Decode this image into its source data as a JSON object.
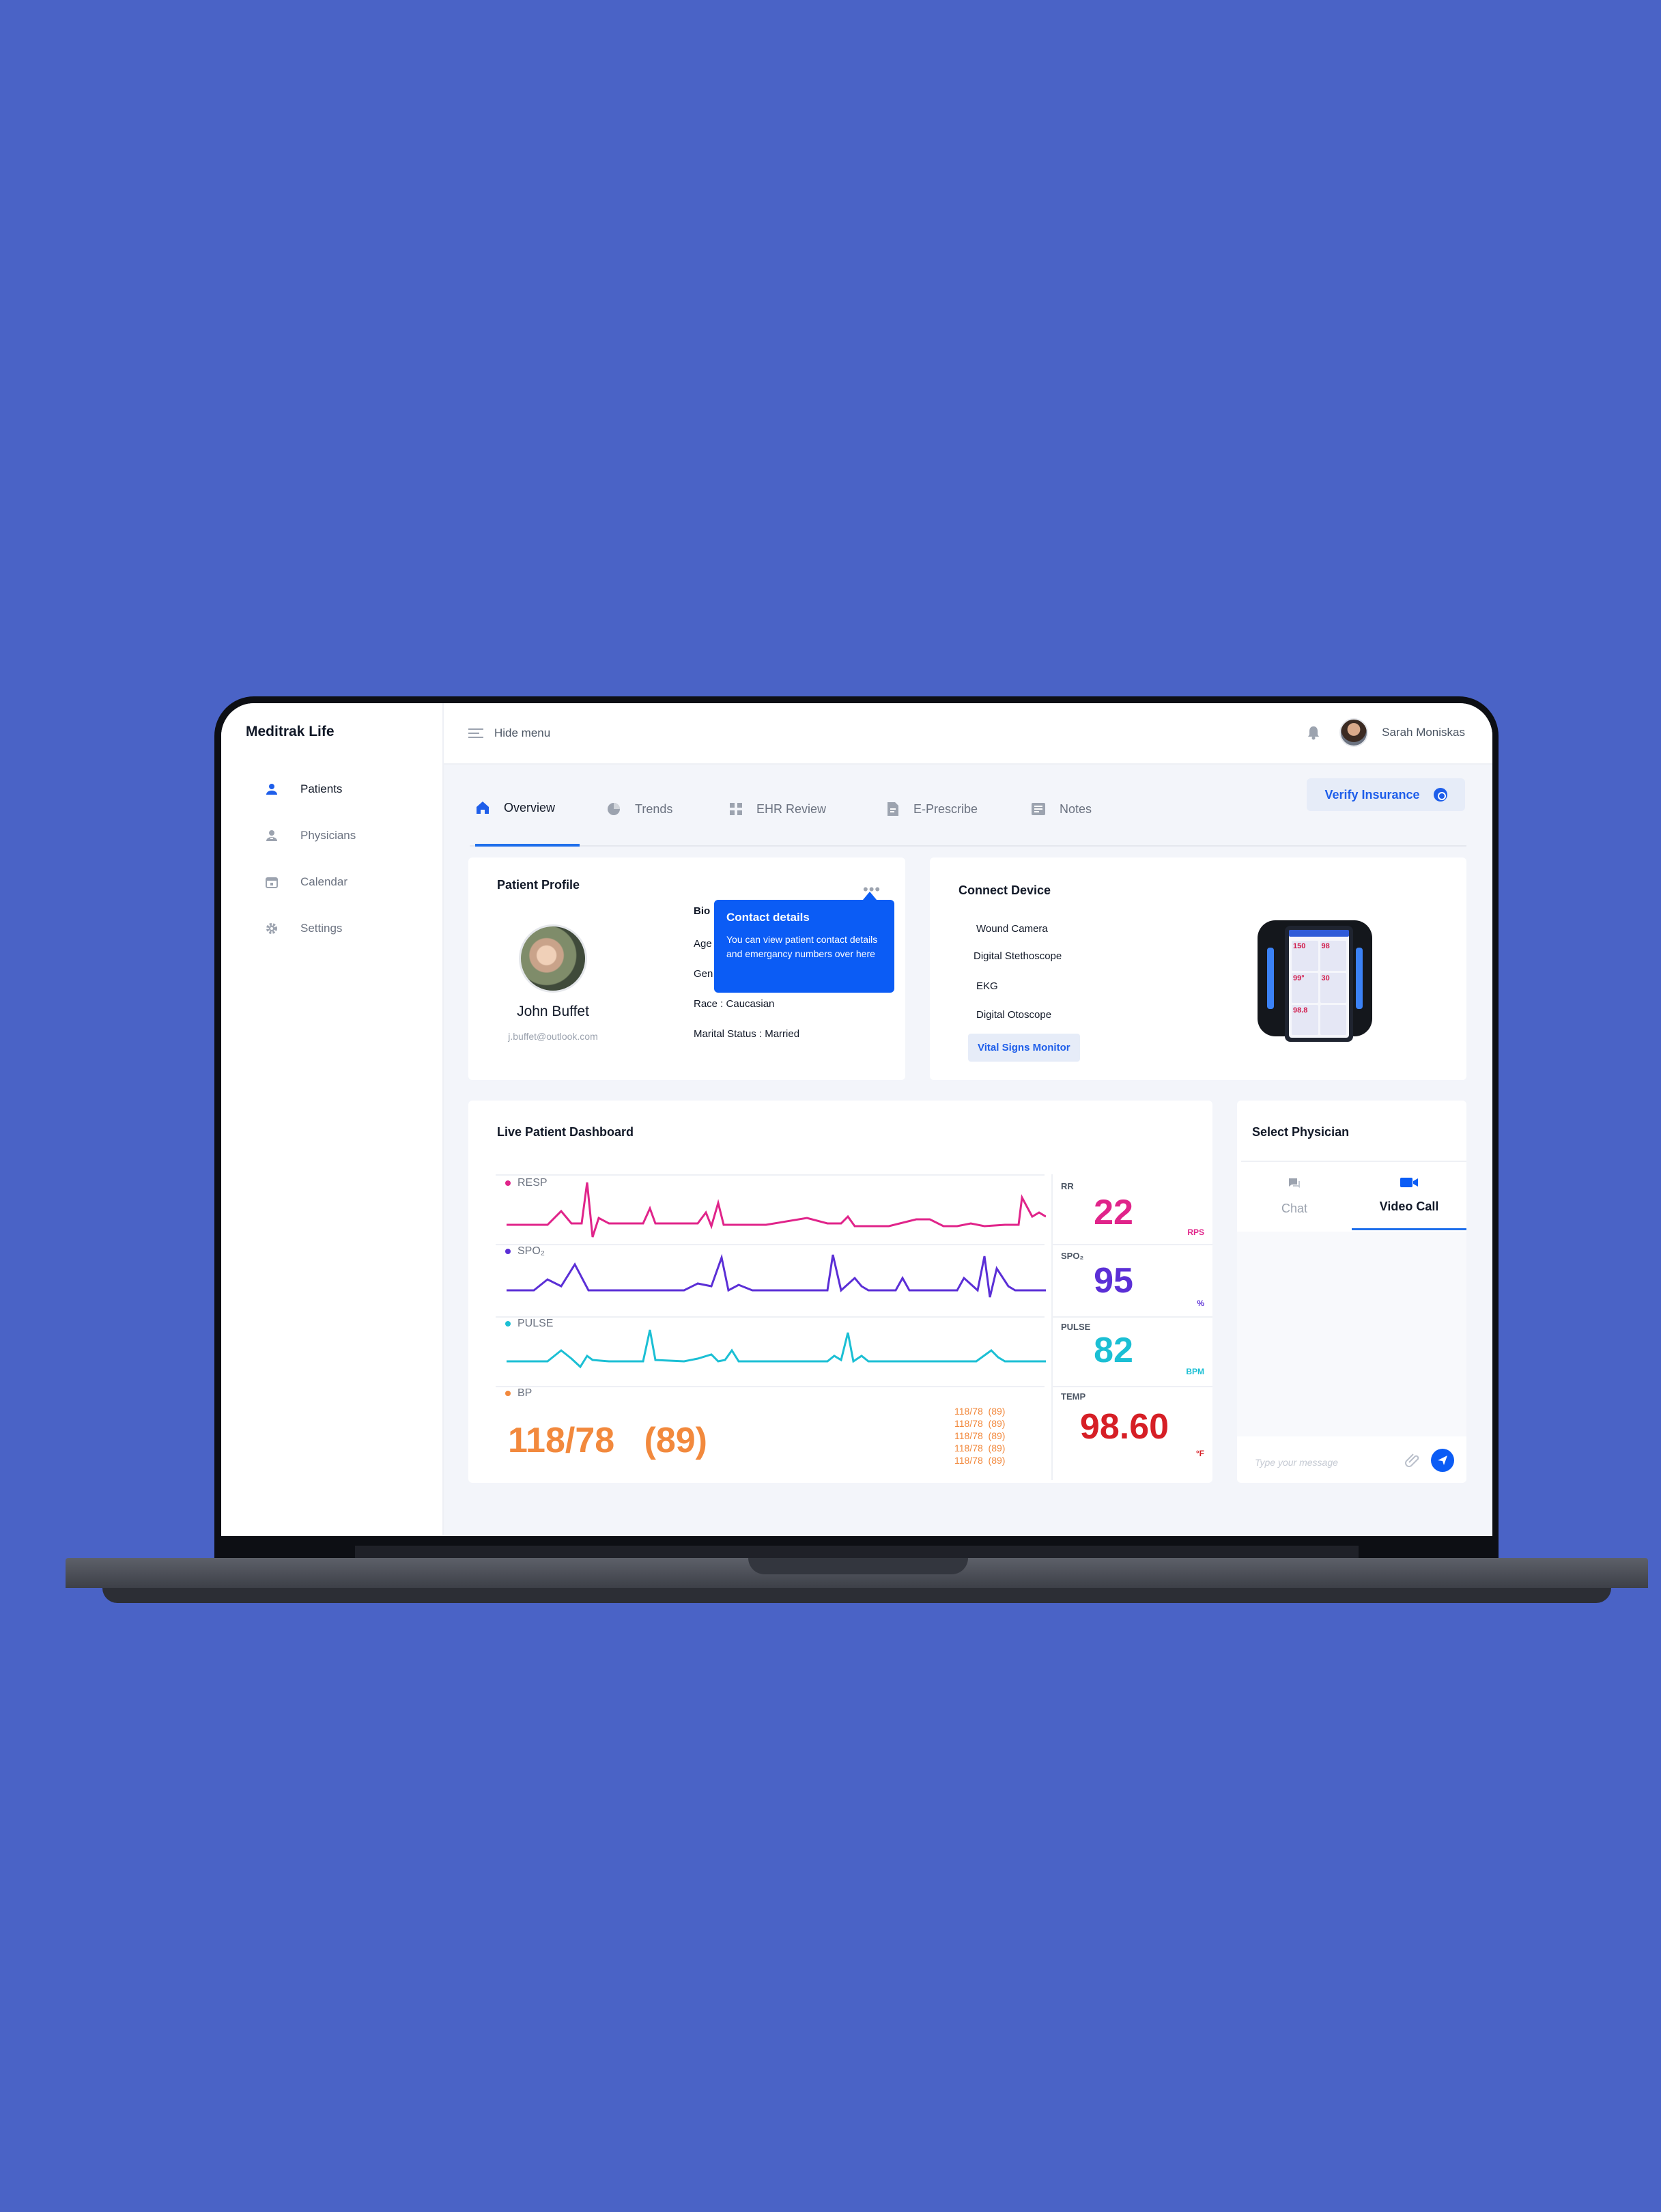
{
  "app": {
    "name": "Meditrak Life"
  },
  "sidebar": {
    "items": [
      {
        "label": "Patients",
        "icon": "person-icon",
        "active": true
      },
      {
        "label": "Physicians",
        "icon": "doctor-icon",
        "active": false
      },
      {
        "label": "Calendar",
        "icon": "calendar-icon",
        "active": false
      },
      {
        "label": "Settings",
        "icon": "gear-icon",
        "active": false
      }
    ]
  },
  "topbar": {
    "hide_menu": "Hide menu",
    "user_name": "Sarah Moniskas"
  },
  "tabs": [
    {
      "label": "Overview",
      "icon": "home-icon",
      "active": true
    },
    {
      "label": "Trends",
      "icon": "pie-chart-icon"
    },
    {
      "label": "EHR Review",
      "icon": "grid-icon"
    },
    {
      "label": "E-Prescribe",
      "icon": "document-icon"
    },
    {
      "label": "Notes",
      "icon": "notes-icon"
    }
  ],
  "verify_insurance": "Verify Insurance",
  "patient_profile": {
    "title": "Patient Profile",
    "name": "John Buffet",
    "email": "j.buffet@outlook.com",
    "bio_label": "Bio",
    "age_label": "Age",
    "gender_label": "Gen",
    "race": "Race : Caucasian",
    "marital": "Marital Status : Married"
  },
  "tooltip": {
    "title": "Contact details",
    "body": "You can view patient contact details and emergancy numbers over here"
  },
  "connect_device": {
    "title": "Connect Device",
    "devices": [
      "Wound Camera",
      "Digital Stethoscope",
      "EKG",
      "Digital Otoscope",
      "Vital Signs Monitor"
    ],
    "selected": "Vital Signs Monitor",
    "monitor_readings": [
      "150",
      "98",
      "99°",
      "30",
      "98.8",
      ""
    ]
  },
  "live_dashboard": {
    "title": "Live Patient Dashboard",
    "rows": [
      {
        "label": "RESP",
        "color": "#e0248a"
      },
      {
        "label": "SPO₂",
        "color": "#5b2fd6"
      },
      {
        "label": "PULSE",
        "color": "#1bbfd4"
      },
      {
        "label": "BP",
        "color": "#f2893d"
      }
    ],
    "bp_value": "118/78   (89)",
    "bp_history": "118/78  (89)\n118/78  (89)\n118/78  (89)\n118/78  (89)\n118/78  (89)",
    "vitals": [
      {
        "label": "RR",
        "value": "22",
        "unit": "RPS",
        "color": "#e0248a"
      },
      {
        "label": "SPO₂",
        "value": "95",
        "unit": "%",
        "color": "#5b2fd6"
      },
      {
        "label": "PULSE",
        "value": "82",
        "unit": "BPM",
        "color": "#1bbfd4"
      },
      {
        "label": "TEMP",
        "value": "98.60",
        "unit": "°F",
        "color": "#d61f26"
      }
    ]
  },
  "select_physician": {
    "title": "Select Physician",
    "tabs": [
      {
        "label": "Chat",
        "icon": "chat-icon"
      },
      {
        "label": "Video Call",
        "icon": "video-icon",
        "active": true
      }
    ],
    "message_placeholder": "Type your message"
  }
}
